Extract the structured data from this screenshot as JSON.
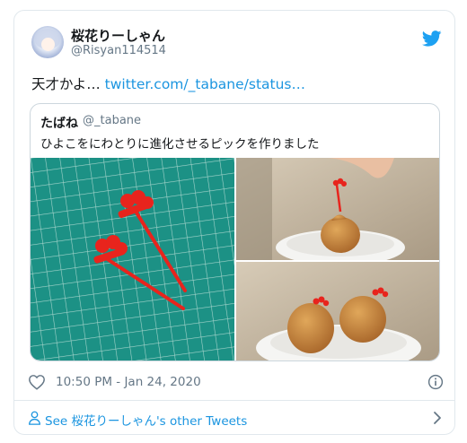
{
  "author": {
    "display_name": "桜花りーしゃん",
    "handle": "@Risyan114514"
  },
  "tweet": {
    "text": "天才かよ…",
    "link_text": "twitter.com/_tabane/status…"
  },
  "quoted_tweet": {
    "display_name": "たばね",
    "handle": "@_tabane",
    "text": "ひよこをにわとりに進化させるピックを作りました"
  },
  "meta": {
    "timestamp": "10:50 PM - Jan 24, 2020"
  },
  "footer": {
    "see_more": "See 桜花りーしゃん's other Tweets"
  },
  "icons": {
    "brand": "twitter-bird-icon",
    "like": "heart-icon",
    "info": "info-icon",
    "profile": "person-icon",
    "more": "chevron-right-icon"
  },
  "colors": {
    "link": "#1b95e0",
    "twitter_blue": "#1da1f2",
    "secondary_text": "#657786",
    "border": "#e1e8ed",
    "pick_red": "#e8241d"
  }
}
